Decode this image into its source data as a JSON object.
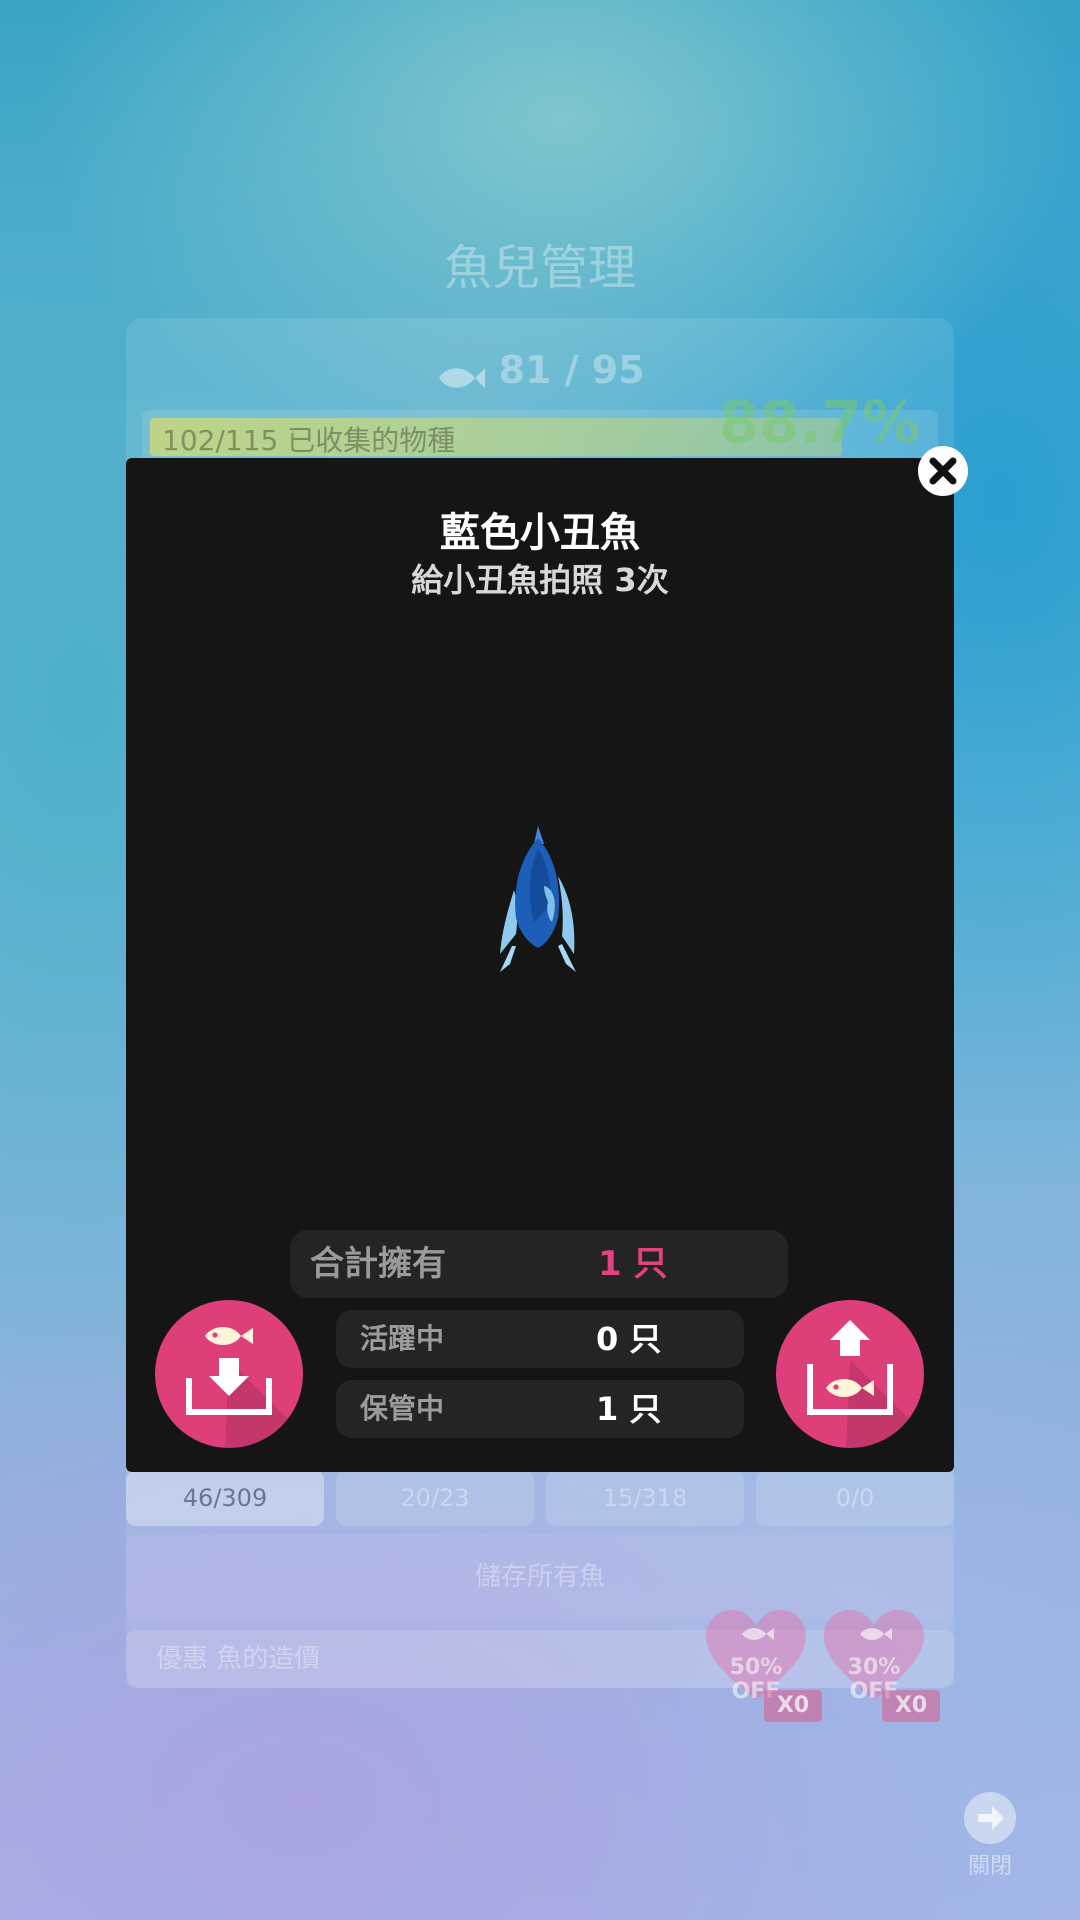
{
  "background": {
    "title": "魚兒管理",
    "fish_count": "81 / 95",
    "progress_text": "102/115 已收集的物種",
    "progress_fraction": 0.887,
    "percent": "88.7%",
    "tabs": [
      {
        "label": "46/309"
      },
      {
        "label": "20/23"
      },
      {
        "label": "15/318"
      },
      {
        "label": "0/0"
      }
    ],
    "save_all_label": "儲存所有魚",
    "discount_label": "優惠 魚的造價",
    "coupons": [
      {
        "percent": "50%",
        "off": "OFF",
        "badge": "X0"
      },
      {
        "percent": "30%",
        "off": "OFF",
        "badge": "X0"
      }
    ],
    "close_label": "關閉"
  },
  "modal": {
    "title": "藍色小丑魚",
    "subtitle": "給小丑魚拍照 3次",
    "total_label": "合計擁有",
    "total_value": "1 只",
    "active_label": "活躍中",
    "active_value": "0 只",
    "stored_label": "保管中",
    "stored_value": "1 只"
  },
  "colors": {
    "accent_pink": "#de3f7b",
    "modal_bg": "#151515",
    "total_value_color": "#e0437f"
  },
  "icons": {
    "close": "close-icon",
    "store": "store-fish-icon",
    "release": "release-fish-icon"
  }
}
